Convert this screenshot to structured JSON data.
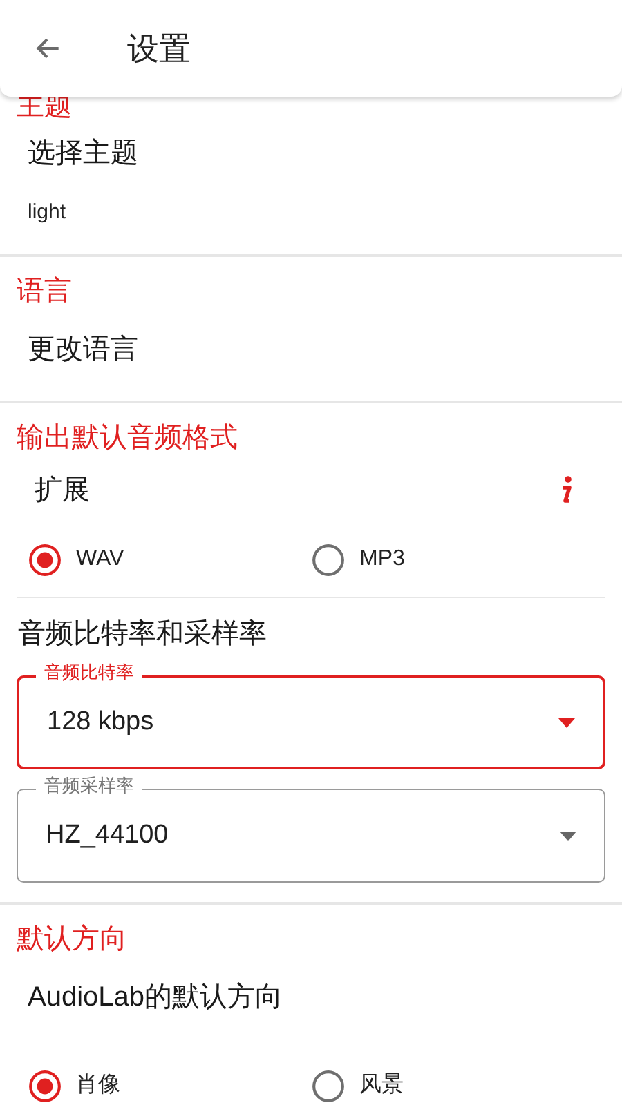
{
  "toolbar": {
    "title": "设置"
  },
  "sections": [
    {
      "header": "主题",
      "items": [
        {
          "kind": "text",
          "title": "选择主题",
          "summary": "light"
        }
      ]
    },
    {
      "header": "语言",
      "items": [
        {
          "kind": "text",
          "title": "更改语言"
        }
      ]
    },
    {
      "header": "输出默认音频格式",
      "items": [
        {
          "kind": "info",
          "title": "扩展"
        },
        {
          "kind": "radios",
          "options": [
            {
              "label": "WAV",
              "selected": true
            },
            {
              "label": "MP3",
              "selected": false
            }
          ]
        },
        {
          "kind": "subheading",
          "title": "音频比特率和采样率"
        },
        {
          "kind": "dropdown",
          "label": "音频比特率",
          "value": "128 kbps",
          "focused": true
        },
        {
          "kind": "dropdown",
          "label": "音频采样率",
          "value": "HZ_44100",
          "focused": false
        }
      ]
    },
    {
      "header": "默认方向",
      "items": [
        {
          "kind": "text",
          "title": "AudioLab的默认方向"
        },
        {
          "kind": "radios",
          "options": [
            {
              "label": "肖像",
              "selected": true
            },
            {
              "label": "风景",
              "selected": false
            }
          ]
        }
      ]
    }
  ]
}
